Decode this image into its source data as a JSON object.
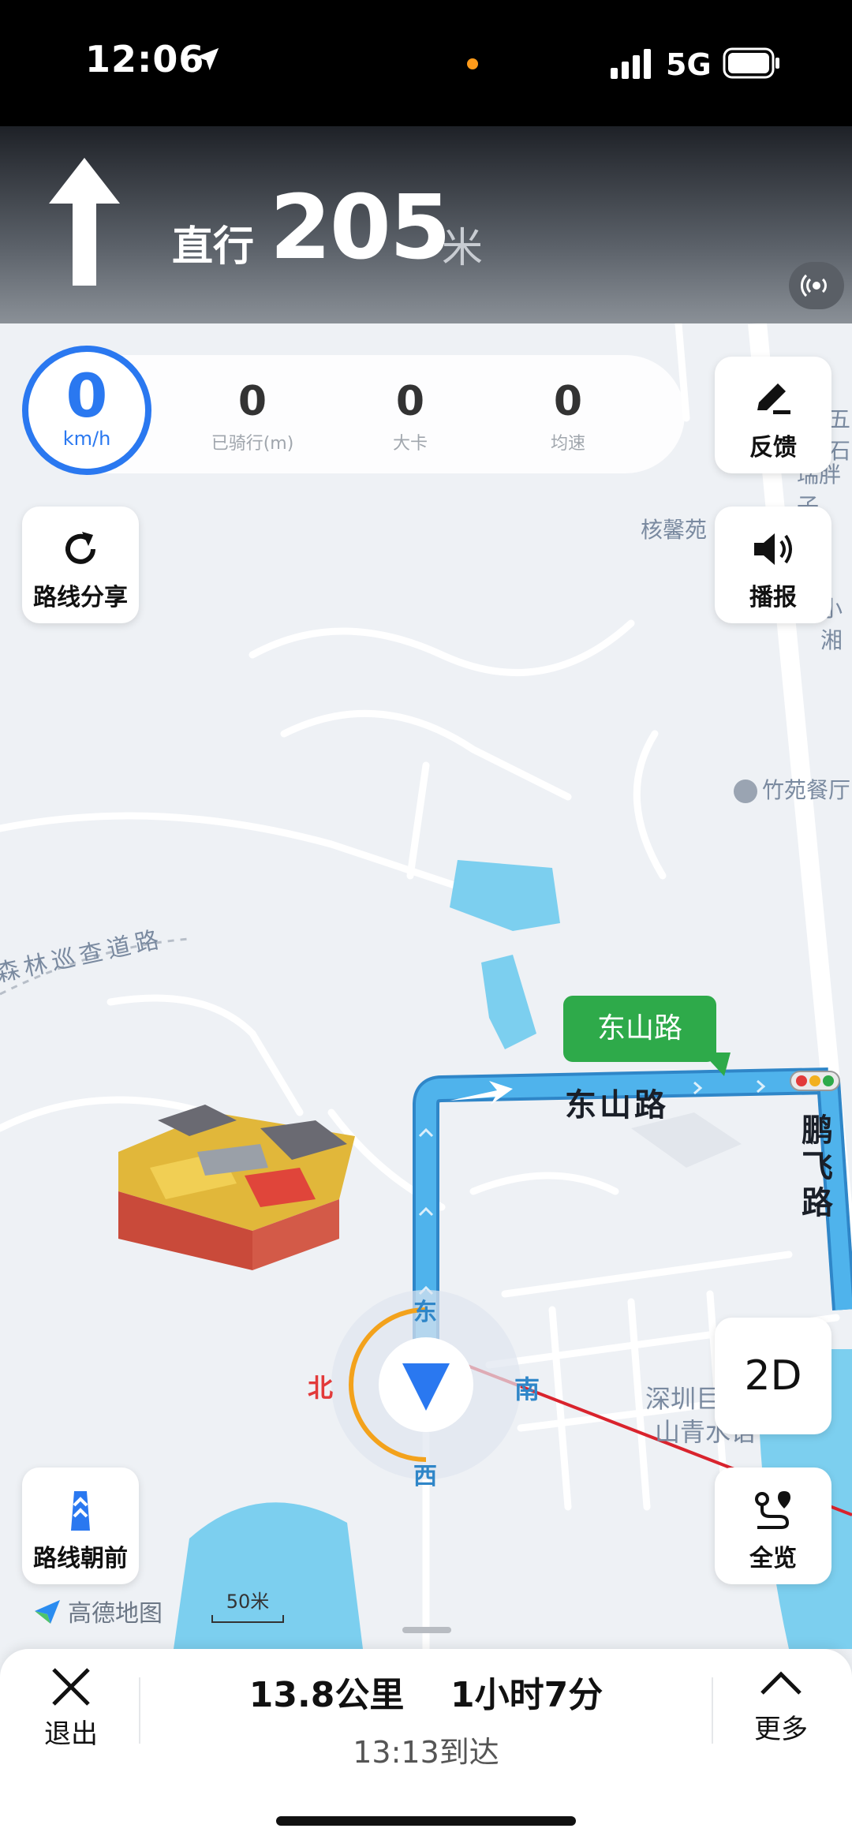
{
  "status_bar": {
    "time": "12:06",
    "network": "5G"
  },
  "navigation": {
    "action": "直行",
    "distance": "205",
    "unit": "米"
  },
  "speed_panel": {
    "speed": "0",
    "speed_unit": "km/h",
    "stats": [
      {
        "value": "0",
        "label": "已骑行(m)"
      },
      {
        "value": "0",
        "label": "大卡"
      },
      {
        "value": "0",
        "label": "均速"
      }
    ]
  },
  "buttons": {
    "feedback": "反馈",
    "broadcast": "播报",
    "route_share": "路线分享",
    "view_2d": "2D",
    "route_forward": "路线朝前",
    "overview": "全览"
  },
  "map": {
    "labels": {
      "heyuan": "核馨苑",
      "zhuyuan_restaurant": "竹苑餐厅",
      "patrol_road": "森林巡查道路",
      "dongshan_callout": "东山路",
      "dongshan_road": "东山路",
      "pengfei_road": "鹏飞路",
      "shenzhen_poi_1": "深圳巨",
      "shenzhen_poi_2": "山青水语",
      "edge_1": "五石",
      "edge_2": "瑞胖子",
      "edge_3": "小湘"
    },
    "compass": {
      "north": "北",
      "east": "东",
      "south": "南",
      "west": "西"
    },
    "logo": "高德地图",
    "scale": "50米"
  },
  "bottom_bar": {
    "exit_label": "退出",
    "distance": "13.8公里",
    "duration": "1小时7分",
    "arrival": "13:13到达",
    "more_label": "更多"
  },
  "colors": {
    "route": "#4fb3ec",
    "accent": "#2a78f0",
    "callout": "#2eaa4a"
  }
}
